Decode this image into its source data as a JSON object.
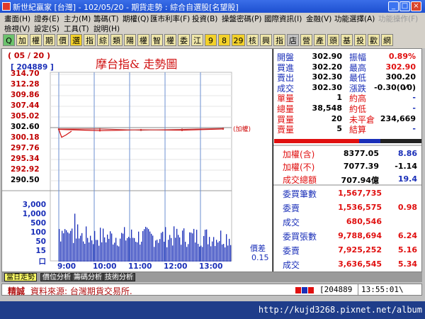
{
  "window": {
    "title": "新世紀贏家 [台灣] - 102/05/20 - 期貨走勢 : 綜合自選股[名望股]",
    "buttons": [
      "_",
      "□",
      "×"
    ]
  },
  "menu1": [
    "畫面(H)",
    "證券(E)",
    "主力(M)",
    "籌碼(T)",
    "期權(Q)",
    "匯市利率(F)",
    "投資(B)",
    "操盤密碼(P)",
    "國際資訊(I)",
    "金融(V)",
    "功能選擇(A)",
    "功能操作(F)"
  ],
  "menu2": [
    "檢視(V)",
    "設定(S)",
    "工具(T)",
    "說明(H)"
  ],
  "toolbar": [
    "Q",
    "加",
    "權",
    "期",
    "價",
    "選",
    "指",
    "綜",
    "類",
    "陽",
    "權",
    "智",
    "權",
    "委",
    "江",
    "9",
    "8",
    "29",
    "核",
    "興",
    "指",
    "店",
    "營",
    "產",
    "頭",
    "基",
    "投",
    "歡",
    "網"
  ],
  "chart": {
    "date": "( 05 / 20 )",
    "code": "[ 204889 ]",
    "title": "摩台指& 走勢圖",
    "price_ticks": [
      "314.70",
      "312.28",
      "309.86",
      "307.44",
      "305.02",
      "302.60",
      "300.18",
      "297.76",
      "295.34",
      "292.92",
      "290.50"
    ],
    "vol_ticks": [
      "3,000",
      "1,000",
      "500",
      "100",
      "50",
      "15",
      "口"
    ],
    "time_ticks": [
      "9:00",
      "10:00",
      "11:00",
      "12:00",
      "13:00"
    ],
    "weighted_tag": "(加權)",
    "spread_label": "價差",
    "spread_value": "0.15"
  },
  "chart_data": {
    "type": "line",
    "title": "摩台指& 走勢圖",
    "xlabel": "",
    "ylabel": "",
    "x": [
      "9:00",
      "10:00",
      "11:00",
      "12:00",
      "13:00"
    ],
    "ylim": [
      290.5,
      314.7
    ],
    "reference_price": 302.6,
    "series": [
      {
        "name": "",
        "values": [
          302.2,
          301.9,
          302.1,
          302.0,
          302.3
        ]
      },
      {
        "name": "(加權)",
        "values": [
          302.3,
          302.3,
          302.0,
          302.2,
          302.4
        ]
      }
    ],
    "volume": {
      "ylim": [
        0,
        3000
      ],
      "ticks": [
        "3,000",
        "1,000",
        "500",
        "100",
        "50",
        "15"
      ]
    }
  },
  "quote": {
    "rows": [
      {
        "l1": "開盤",
        "v1": "302.90",
        "l2": "振幅",
        "v2": "0.89%"
      },
      {
        "l1": "買進",
        "v1": "302.20",
        "l2": "最高",
        "v2": "302.90"
      },
      {
        "l1": "賣出",
        "v1": "302.30",
        "l2": "最低",
        "v2": "300.20"
      },
      {
        "l1": "成交",
        "v1": "302.30",
        "l2": "漲跌",
        "v2": "-0.30(0⁄0)"
      },
      {
        "l1": "單量",
        "v1": "1",
        "l2": "約高",
        "v2": "-"
      },
      {
        "l1": "總量",
        "v1": "38,548",
        "l2": "約低",
        "v2": "-"
      },
      {
        "l1": "買量",
        "v1": "20",
        "l2": "未平倉",
        "v2": "234,669"
      },
      {
        "l1": "賣量",
        "v1": "5",
        "l2": "結算",
        "v2": "-"
      }
    ],
    "index": [
      {
        "label": "加權(含)",
        "v1": "8377.05",
        "v2": "8.86"
      },
      {
        "label": "加權(不)",
        "v1": "7077.39",
        "v2": "-1.14"
      },
      {
        "label": "成交總額",
        "v1": "707.94億",
        "v2": "19.4"
      }
    ],
    "orders": [
      {
        "label": "委買筆數",
        "v1": "1,567,735",
        "v2": ""
      },
      {
        "label": "委賣",
        "v1": "1,536,575",
        "v2": "0.98"
      },
      {
        "label": "成交",
        "v1": "680,546",
        "v2": ""
      },
      {
        "label": "委買張數",
        "v1": "9,788,694",
        "v2": "6.24"
      },
      {
        "label": "委賣",
        "v1": "7,925,252",
        "v2": "5.16"
      },
      {
        "label": "成交",
        "v1": "3,636,545",
        "v2": "5.34"
      }
    ]
  },
  "tabs": [
    "當日走勢",
    "價位分析",
    "籌碼分析",
    "技術分析"
  ],
  "status": {
    "left_tag": "精誠",
    "message": "資料來源: 台灣期貨交易所.",
    "code": "[204889",
    "time": "13:55:01\\"
  },
  "taskbar": {
    "url": "http://kujd3268.pixnet.net/album"
  }
}
